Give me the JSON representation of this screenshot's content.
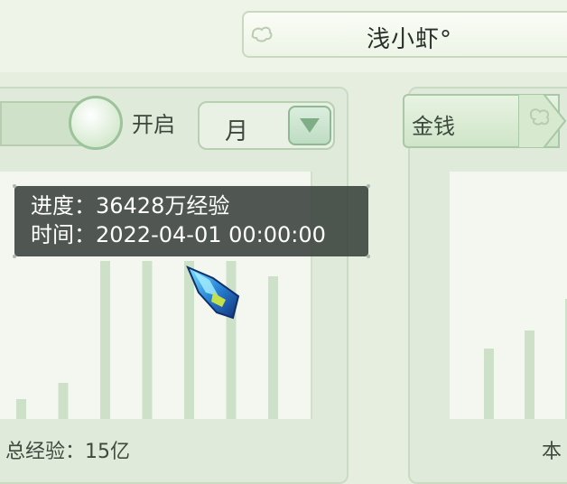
{
  "header": {
    "player_name": "浅小虾°"
  },
  "left_panel": {
    "toggle": {
      "label": "开启",
      "state": "on"
    },
    "period_select": {
      "value": "月"
    },
    "tooltip": {
      "progress_label": "进度：",
      "progress_value": "36428万经验",
      "time_label": "时间：",
      "time_value": "2022-04-01 00:00:00"
    },
    "footer": {
      "label": "总经验：",
      "value": "15亿"
    }
  },
  "right_panel": {
    "tab_label": "金钱",
    "footer_partial": "本"
  },
  "chart_data": [
    {
      "type": "bar",
      "title": "",
      "xlabel": "",
      "ylabel": "",
      "values": [
        22,
        40,
        175,
        175,
        175,
        175,
        158
      ],
      "ylim": [
        0,
        200
      ],
      "grid": false,
      "bar_color": "#cde0c8",
      "note_highlight": "tooltip shows 36428万经验 at 2022-04-01 00:00:00"
    },
    {
      "type": "bar",
      "title": "",
      "values": [
        78,
        98,
        133
      ],
      "ylim": [
        0,
        200
      ],
      "bar_color": "#cde0c8"
    }
  ],
  "colors": {
    "background": "#e6efdf",
    "panel": "#dfeadb",
    "chart_bg": "#f3f7ef",
    "bar": "#cde0c8",
    "tooltip_bg": "#343c38",
    "accent_green": "#9cc39a"
  },
  "icons": {
    "banner_ornament": "cloud-ornament-icon",
    "dropdown": "triangle-down-icon",
    "cursor": "gem-cursor-icon"
  }
}
